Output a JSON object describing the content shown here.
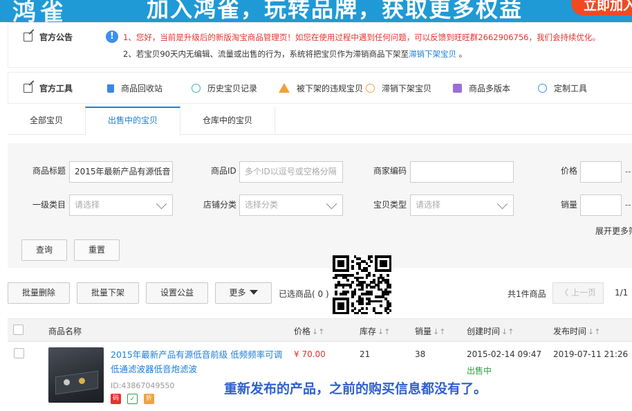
{
  "banner": {
    "logo": "鸿雀",
    "slogan": "加入鸿雀，玩转品牌，获取更多权益",
    "cta": "立即加入"
  },
  "notice": {
    "title": "官方公告",
    "line1": "1、您好，当前是升级后的新版淘宝商品管理页！如您在使用过程中遇到任何问题，可以反馈到旺旺群2662906756，我们会持续优化。",
    "line2_prefix": "2、若宝贝90天内无编辑、流量或出售的行为，系统将把宝贝作为滞销商品下架至",
    "line2_link": "滞销下架宝贝",
    "line2_suffix": "。"
  },
  "tools": {
    "title": "官方工具",
    "items": [
      {
        "label": "商品回收站",
        "icon": "trash-icon"
      },
      {
        "label": "历史宝贝记录",
        "icon": "history-icon"
      },
      {
        "label": "被下架的违规宝贝",
        "icon": "warning-icon"
      },
      {
        "label": "滞销下架宝贝",
        "icon": "slow-sale-icon"
      },
      {
        "label": "商品多版本",
        "icon": "multi-version-icon"
      },
      {
        "label": "定制工具",
        "icon": "custom-tool-icon"
      }
    ]
  },
  "tabs": [
    {
      "label": "全部宝贝",
      "active": false
    },
    {
      "label": "出售中的宝贝",
      "active": true
    },
    {
      "label": "仓库中的宝贝",
      "active": false
    }
  ],
  "filter": {
    "title_label": "商品标题",
    "title_value": "2015年最新产品有源低音",
    "id_label": "商品ID",
    "id_placeholder": "多个ID以逗号或空格分隔",
    "merchant_code_label": "商家编码",
    "merchant_code_value": "",
    "price_label": "价格",
    "category_label": "一级类目",
    "category_placeholder": "请选择",
    "shop_category_label": "店铺分类",
    "shop_category_placeholder": "选择分类",
    "item_type_label": "宝贝类型",
    "item_type_placeholder": "请选择",
    "sales_label": "销量",
    "range_sep": "--",
    "expand": "展开更多筛",
    "search": "查询",
    "reset": "重置"
  },
  "actions": {
    "batch_delete": "批量删除",
    "batch_delist": "批量下架",
    "set_charity": "设置公益",
    "more": "更多",
    "selected": "已选商品( 0 )",
    "total": "共1件商品",
    "prev": "上一页",
    "page": "1/1"
  },
  "table": {
    "headers": {
      "name": "商品名称",
      "price": "价格",
      "stock": "库存",
      "sales": "销量",
      "created": "创建时间",
      "published": "发布时间"
    },
    "sort_glyph": "↓↑",
    "rows": [
      {
        "title": "2015年最新产品有源低音前级 低频频率可调 低通滤波器低音炮滤波",
        "id": "ID:43867049550",
        "badges": [
          "码",
          "",
          "折"
        ],
        "price": "¥ 70.00",
        "stock": "21",
        "sales": "38",
        "created": "2015-02-14 09:47",
        "status": "出售中",
        "published": "2019-07-11 21:26"
      }
    ]
  },
  "overlay_caption": "重新发布的产品，之前的购买信息都没有了。",
  "colors": {
    "link": "#1d7ed6",
    "alert": "#e5332c",
    "success": "#2f9e44",
    "banner": "#1f9ad6"
  }
}
